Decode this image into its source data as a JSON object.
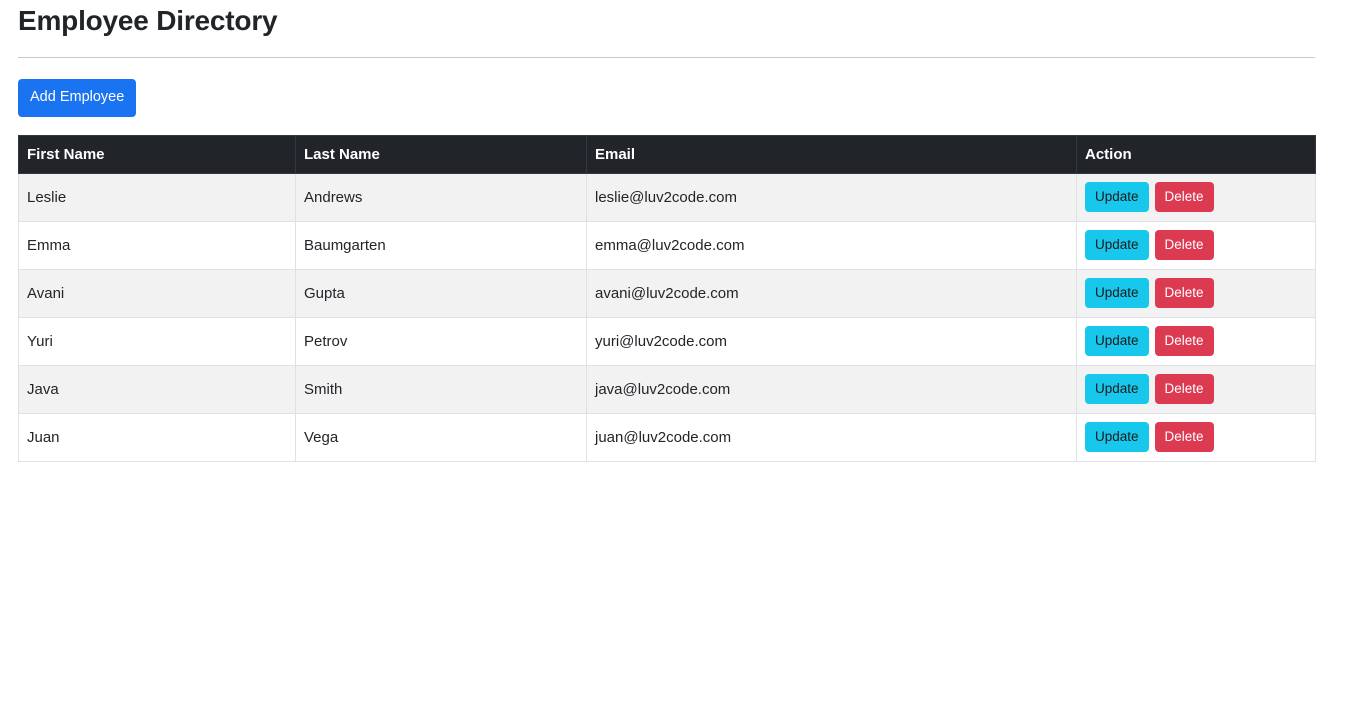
{
  "header": {
    "title": "Employee Directory"
  },
  "toolbar": {
    "add_employee_label": "Add Employee"
  },
  "table": {
    "columns": [
      {
        "key": "first_name",
        "label": "First Name"
      },
      {
        "key": "last_name",
        "label": "Last Name"
      },
      {
        "key": "email",
        "label": "Email"
      },
      {
        "key": "action",
        "label": "Action"
      }
    ],
    "row_actions": {
      "update_label": "Update",
      "delete_label": "Delete"
    },
    "rows": [
      {
        "first_name": "Leslie",
        "last_name": "Andrews",
        "email": "leslie@luv2code.com"
      },
      {
        "first_name": "Emma",
        "last_name": "Baumgarten",
        "email": "emma@luv2code.com"
      },
      {
        "first_name": "Avani",
        "last_name": "Gupta",
        "email": "avani@luv2code.com"
      },
      {
        "first_name": "Yuri",
        "last_name": "Petrov",
        "email": "yuri@luv2code.com"
      },
      {
        "first_name": "Java",
        "last_name": "Smith",
        "email": "java@luv2code.com"
      },
      {
        "first_name": "Juan",
        "last_name": "Vega",
        "email": "juan@luv2code.com"
      }
    ]
  },
  "colors": {
    "add_button": "#1a73f0",
    "update_button": "#17c7ec",
    "delete_button": "#dc3a51",
    "table_header": "#212529",
    "row_stripe": "#f2f2f2"
  }
}
